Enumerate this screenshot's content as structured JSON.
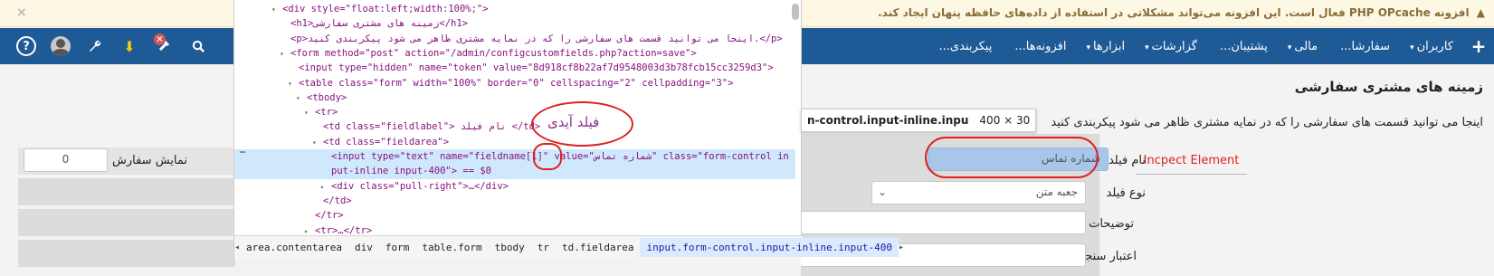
{
  "warning": {
    "text": "افزونه PHP OPcache فعال است. این افزونه می‌تواند مشکلاتی در استفاده از داده‌های حافظه پنهان ایجاد کند.",
    "close_label": "×"
  },
  "nav": {
    "plus_label": "+",
    "items": [
      {
        "label": "کاربران",
        "caret": "▾"
      },
      {
        "label": "سفارشا...",
        "caret": ""
      },
      {
        "label": "مالی",
        "caret": "▾"
      },
      {
        "label": "پشتیبان...",
        "caret": ""
      },
      {
        "label": "گزارشات",
        "caret": "▾"
      },
      {
        "label": "ابزارها",
        "caret": "▾"
      },
      {
        "label": "افزونه‌ها...",
        "caret": ""
      },
      {
        "label": "پیکربندی...",
        "caret": ""
      }
    ],
    "help_label": "?"
  },
  "page": {
    "title": "زمینه های مشتری سفارشی",
    "description": "اینجا می توانید قسمت های سفارشی را که در نمایه مشتری ظاهر می شود پیکربندی کنید"
  },
  "form": {
    "field_name_label": "نام فیلد",
    "field_name_value": "شماره تماس",
    "field_type_label": "نوع فیلد",
    "field_type_value": "جعبه متن",
    "description_label": "توضیحات",
    "validation_label": "اعتبار سنجی",
    "display_order_label": "نمایش سفارش",
    "display_order_value": "0",
    "inspect_label": "Incpect Element"
  },
  "devtools": {
    "lines": [
      {
        "indent": 3,
        "arrow": "▾",
        "html": "&lt;div style=\"float:left;width:100%;\"&gt;"
      },
      {
        "indent": 4,
        "arrow": "",
        "html": "&lt;h1&gt;زمینه های مشتری سفارشی&lt;/h1&gt;"
      },
      {
        "indent": 4,
        "arrow": "",
        "html": "&lt;p&gt;اینجا می توانید قسمت های سفارشی را که در نمایه مشتری ظاهر می شود پیکربندی کنید.&lt;/p&gt;"
      },
      {
        "indent": 4,
        "arrow": "▾",
        "html": "&lt;form method=\"post\" action=\"/admin/configcustomfields.php?action=save\"&gt;"
      },
      {
        "indent": 5,
        "arrow": "",
        "html": "&lt;input type=\"hidden\" name=\"token\" value=\"8d918cf8b22af7d9548003d3b78fcb15cc3259d3\"&gt;"
      },
      {
        "indent": 5,
        "arrow": "▾",
        "html": "&lt;table class=\"form\" width=\"100%\" border=\"0\" cellspacing=\"2\" cellpadding=\"3\"&gt;"
      },
      {
        "indent": 6,
        "arrow": "▾",
        "html": "&lt;tbody&gt;"
      },
      {
        "indent": 7,
        "arrow": "▾",
        "html": "&lt;tr&gt;"
      },
      {
        "indent": 8,
        "arrow": "",
        "html": "&lt;td class=\"fieldlabel\"&gt; نام فیلد &lt;/td&gt;"
      },
      {
        "indent": 8,
        "arrow": "▾",
        "html": "&lt;td class=\"fieldarea\"&gt;"
      },
      {
        "indent": 9,
        "arrow": "",
        "html": "&lt;input type=\"text\" name=\"fieldname[1]\" value=\"شماره تماس\" class=\"form-control in"
      },
      {
        "indent": 9,
        "arrow": "",
        "html": "put-inline input-400\"&gt; == $0"
      },
      {
        "indent": 9,
        "arrow": "▸",
        "html": "&lt;div class=\"pull-right\"&gt;…&lt;/div&gt;"
      },
      {
        "indent": 8,
        "arrow": "",
        "html": "&lt;/td&gt;"
      },
      {
        "indent": 7,
        "arrow": "",
        "html": "&lt;/tr&gt;"
      },
      {
        "indent": 7,
        "arrow": "▸",
        "html": "&lt;tr&gt;…&lt;/tr&gt;"
      }
    ],
    "selected_marker": "…",
    "breadcrumbs": [
      "area.contentarea",
      "div",
      "form",
      "table.form",
      "tbody",
      "tr",
      "td.fieldarea",
      "input.form-control.input-inline.input-400"
    ],
    "left_arrow": "◂",
    "right_arrow": "▸"
  },
  "tooltip": {
    "selector": "n-control.input-inline.inpu",
    "size": "400 × 30"
  },
  "annotation": {
    "field_id_label": "فیلد آیدی"
  }
}
